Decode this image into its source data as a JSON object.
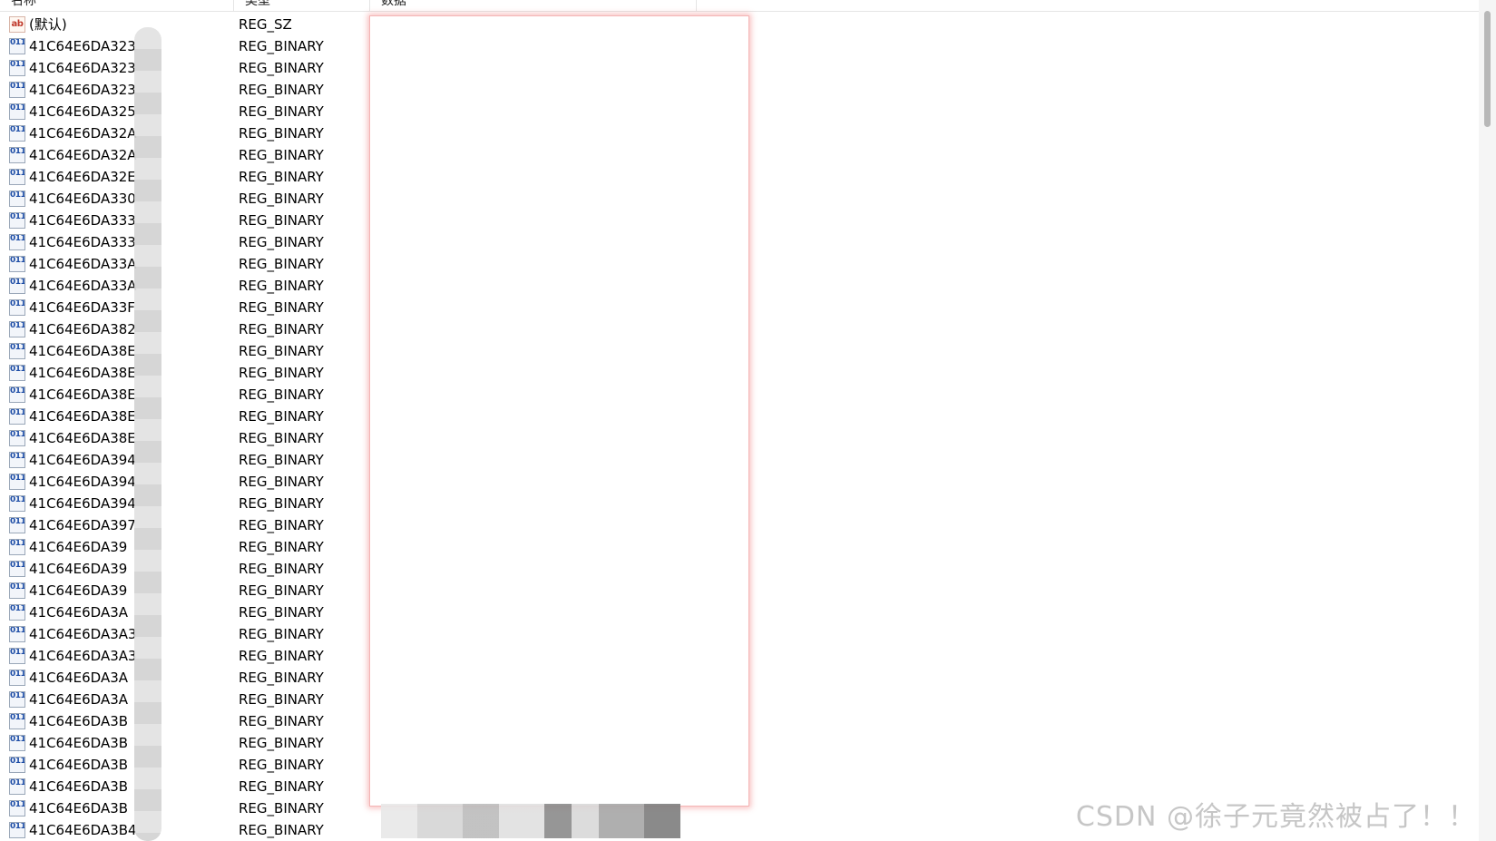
{
  "columns": {
    "name": "名称",
    "type": "类型",
    "data": "数据"
  },
  "rows": [
    {
      "icon": "string-value-icon",
      "name": "(默认)",
      "type": "REG_SZ"
    },
    {
      "icon": "binary-value-icon",
      "name": "41C64E6DA323",
      "type": "REG_BINARY"
    },
    {
      "icon": "binary-value-icon",
      "name": "41C64E6DA323",
      "type": "REG_BINARY"
    },
    {
      "icon": "binary-value-icon",
      "name": "41C64E6DA323",
      "type": "REG_BINARY"
    },
    {
      "icon": "binary-value-icon",
      "name": "41C64E6DA325",
      "type": "REG_BINARY"
    },
    {
      "icon": "binary-value-icon",
      "name": "41C64E6DA32A",
      "type": "REG_BINARY"
    },
    {
      "icon": "binary-value-icon",
      "name": "41C64E6DA32A",
      "type": "REG_BINARY"
    },
    {
      "icon": "binary-value-icon",
      "name": "41C64E6DA32E",
      "type": "REG_BINARY"
    },
    {
      "icon": "binary-value-icon",
      "name": "41C64E6DA330",
      "type": "REG_BINARY"
    },
    {
      "icon": "binary-value-icon",
      "name": "41C64E6DA333",
      "type": "REG_BINARY"
    },
    {
      "icon": "binary-value-icon",
      "name": "41C64E6DA333",
      "type": "REG_BINARY"
    },
    {
      "icon": "binary-value-icon",
      "name": "41C64E6DA33A",
      "type": "REG_BINARY"
    },
    {
      "icon": "binary-value-icon",
      "name": "41C64E6DA33A",
      "type": "REG_BINARY"
    },
    {
      "icon": "binary-value-icon",
      "name": "41C64E6DA33F",
      "type": "REG_BINARY"
    },
    {
      "icon": "binary-value-icon",
      "name": "41C64E6DA382",
      "type": "REG_BINARY"
    },
    {
      "icon": "binary-value-icon",
      "name": "41C64E6DA38E",
      "type": "REG_BINARY"
    },
    {
      "icon": "binary-value-icon",
      "name": "41C64E6DA38E",
      "type": "REG_BINARY"
    },
    {
      "icon": "binary-value-icon",
      "name": "41C64E6DA38E",
      "type": "REG_BINARY"
    },
    {
      "icon": "binary-value-icon",
      "name": "41C64E6DA38E",
      "type": "REG_BINARY"
    },
    {
      "icon": "binary-value-icon",
      "name": "41C64E6DA38E",
      "type": "REG_BINARY"
    },
    {
      "icon": "binary-value-icon",
      "name": "41C64E6DA394",
      "type": "REG_BINARY"
    },
    {
      "icon": "binary-value-icon",
      "name": "41C64E6DA394",
      "type": "REG_BINARY"
    },
    {
      "icon": "binary-value-icon",
      "name": "41C64E6DA394",
      "type": "REG_BINARY"
    },
    {
      "icon": "binary-value-icon",
      "name": "41C64E6DA397",
      "type": "REG_BINARY"
    },
    {
      "icon": "binary-value-icon",
      "name": "41C64E6DA39",
      "type": "REG_BINARY"
    },
    {
      "icon": "binary-value-icon",
      "name": "41C64E6DA39",
      "type": "REG_BINARY"
    },
    {
      "icon": "binary-value-icon",
      "name": "41C64E6DA39",
      "type": "REG_BINARY"
    },
    {
      "icon": "binary-value-icon",
      "name": "41C64E6DA3A",
      "type": "REG_BINARY"
    },
    {
      "icon": "binary-value-icon",
      "name": "41C64E6DA3A3",
      "type": "REG_BINARY"
    },
    {
      "icon": "binary-value-icon",
      "name": "41C64E6DA3A3",
      "type": "REG_BINARY"
    },
    {
      "icon": "binary-value-icon",
      "name": "41C64E6DA3A",
      "type": "REG_BINARY"
    },
    {
      "icon": "binary-value-icon",
      "name": "41C64E6DA3A",
      "type": "REG_BINARY"
    },
    {
      "icon": "binary-value-icon",
      "name": "41C64E6DA3B",
      "type": "REG_BINARY"
    },
    {
      "icon": "binary-value-icon",
      "name": "41C64E6DA3B",
      "type": "REG_BINARY"
    },
    {
      "icon": "binary-value-icon",
      "name": "41C64E6DA3B",
      "type": "REG_BINARY"
    },
    {
      "icon": "binary-value-icon",
      "name": "41C64E6DA3B",
      "type": "REG_BINARY"
    },
    {
      "icon": "binary-value-icon",
      "name": "41C64E6DA3B",
      "type": "REG_BINARY"
    },
    {
      "icon": "binary-value-icon",
      "name": "41C64E6DA3B4",
      "type": "REG_BINARY"
    }
  ],
  "icons": {
    "string_glyph": "ab",
    "binary_glyph": "011 110"
  },
  "watermark": "CSDN @徐子元竟然被占了！！",
  "colors": {
    "highlight_border": "#f4b4b4",
    "watermark": "#c6c6c6"
  }
}
